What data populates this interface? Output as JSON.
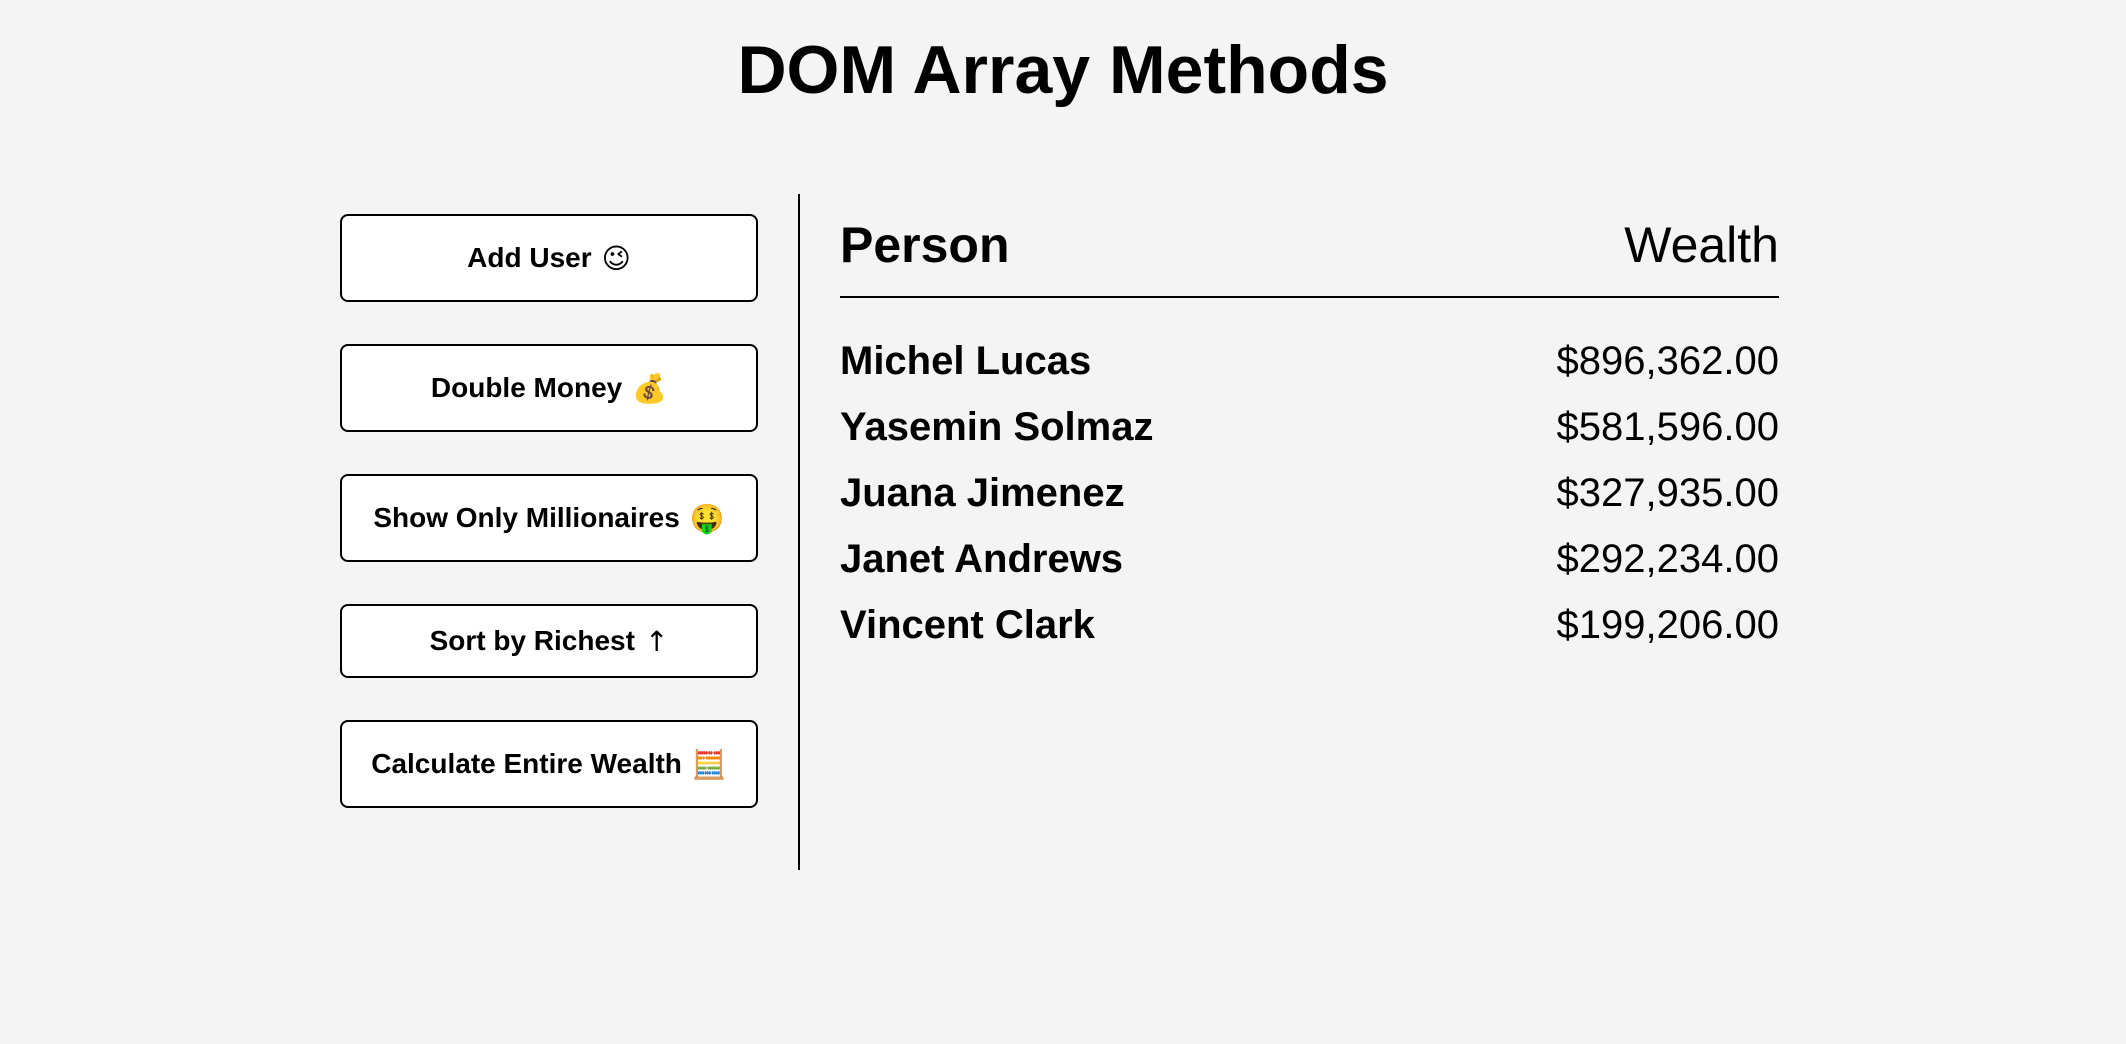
{
  "title": "DOM Array Methods",
  "buttons": {
    "add_user": {
      "label": "Add User",
      "emoji": "😉"
    },
    "double_money": {
      "label": "Double Money",
      "emoji": "💰"
    },
    "show_millionaires": {
      "label": "Show Only Millionaires",
      "emoji": "🤑"
    },
    "sort_richest": {
      "label": "Sort by Richest",
      "emoji": "↑"
    },
    "calculate_wealth": {
      "label": "Calculate Entire Wealth",
      "emoji": "🧮"
    }
  },
  "table": {
    "header_person": "Person",
    "header_wealth": "Wealth",
    "rows": [
      {
        "name": "Michel Lucas",
        "wealth": "$896,362.00"
      },
      {
        "name": "Yasemin Solmaz",
        "wealth": "$581,596.00"
      },
      {
        "name": "Juana Jimenez",
        "wealth": "$327,935.00"
      },
      {
        "name": "Janet Andrews",
        "wealth": "$292,234.00"
      },
      {
        "name": "Vincent Clark",
        "wealth": "$199,206.00"
      }
    ]
  }
}
